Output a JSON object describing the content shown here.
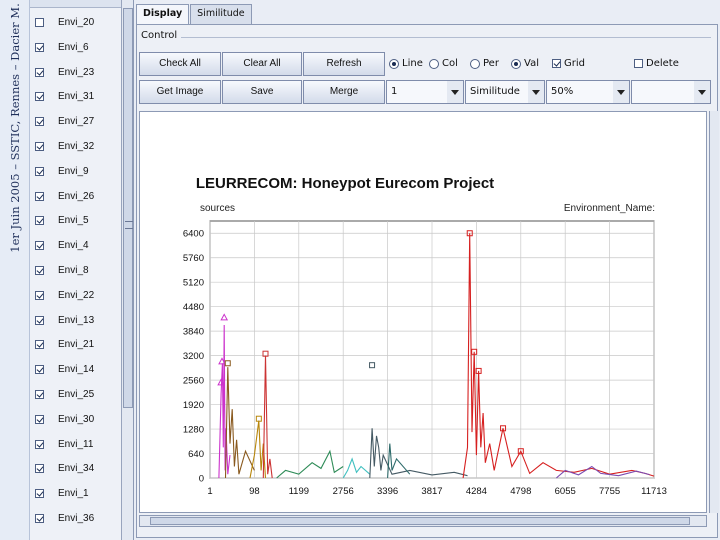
{
  "slide_caption": "1er Juin 2005 – SSTIC, Rennes – Dacier M.",
  "environments": [
    {
      "label": "Envi_20",
      "checked": false
    },
    {
      "label": "Envi_6",
      "checked": true
    },
    {
      "label": "Envi_23",
      "checked": true
    },
    {
      "label": "Envi_31",
      "checked": true
    },
    {
      "label": "Envi_27",
      "checked": true
    },
    {
      "label": "Envi_32",
      "checked": true
    },
    {
      "label": "Envi_9",
      "checked": true
    },
    {
      "label": "Envi_26",
      "checked": true
    },
    {
      "label": "Envi_5",
      "checked": true
    },
    {
      "label": "Envi_4",
      "checked": true
    },
    {
      "label": "Envi_8",
      "checked": true
    },
    {
      "label": "Envi_22",
      "checked": true
    },
    {
      "label": "Envi_13",
      "checked": true
    },
    {
      "label": "Envi_21",
      "checked": true
    },
    {
      "label": "Envi_14",
      "checked": true
    },
    {
      "label": "Envi_25",
      "checked": true
    },
    {
      "label": "Envi_30",
      "checked": true
    },
    {
      "label": "Envi_11",
      "checked": true
    },
    {
      "label": "Envi_34",
      "checked": true
    },
    {
      "label": "Envi_1",
      "checked": true
    },
    {
      "label": "Envi_36",
      "checked": true
    }
  ],
  "tabs": [
    {
      "label": "Display",
      "active": true
    },
    {
      "label": "Similitude",
      "active": false
    }
  ],
  "control": {
    "label": "Control",
    "buttons": {
      "check_all": "Check All",
      "clear_all": "Clear All",
      "refresh": "Refresh",
      "get_image": "Get Image",
      "save": "Save",
      "merge": "Merge"
    },
    "radios": [
      {
        "label": "Line",
        "selected": true
      },
      {
        "label": "Col",
        "selected": false
      },
      {
        "label": "Per",
        "selected": false
      },
      {
        "label": "Val",
        "selected": true
      }
    ],
    "grid": {
      "label": "Grid",
      "checked": true
    },
    "delete": {
      "label": "Delete",
      "checked": false
    },
    "selects": {
      "env_index": "1",
      "mode": "Similitude",
      "zoom": "50%",
      "extra": ""
    }
  },
  "chart_data": {
    "type": "line",
    "title": "LEURRECOM: Honeypot Eurecom Project",
    "ylabel": "sources",
    "legend_label": "Environment_Name:",
    "x_tick_labels": [
      "1",
      "98",
      "1199",
      "2756",
      "3396",
      "3817",
      "4284",
      "4798",
      "6055",
      "7755",
      "11713"
    ],
    "y_ticks": [
      0,
      640,
      1280,
      1920,
      2560,
      3200,
      3840,
      4480,
      5120,
      5760,
      6400
    ],
    "ylim": [
      0,
      6720
    ],
    "grid": true,
    "colors": [
      "#cc33cc",
      "#8a5a1f",
      "#b8860b",
      "#2e8b57",
      "#40c0c0",
      "#455a64",
      "#2e6b6b",
      "#d62020",
      "#7a4ab0",
      "#d4a017"
    ],
    "series": [
      {
        "color": "#cc33cc",
        "points": [
          [
            0.02,
            0
          ],
          [
            0.025,
            2200
          ],
          [
            0.028,
            3000
          ],
          [
            0.03,
            800
          ],
          [
            0.032,
            4000
          ],
          [
            0.034,
            200
          ],
          [
            0.036,
            1300
          ],
          [
            0.04,
            100
          ],
          [
            0.045,
            600
          ]
        ]
      },
      {
        "color": "#8a5a1f",
        "points": [
          [
            0.035,
            0
          ],
          [
            0.04,
            2900
          ],
          [
            0.045,
            900
          ],
          [
            0.05,
            1800
          ],
          [
            0.055,
            300
          ],
          [
            0.06,
            1000
          ],
          [
            0.065,
            100
          ],
          [
            0.08,
            700
          ],
          [
            0.1,
            200
          ]
        ]
      },
      {
        "color": "#b8860b",
        "points": [
          [
            0.09,
            0
          ],
          [
            0.1,
            600
          ],
          [
            0.11,
            1500
          ],
          [
            0.115,
            200
          ],
          [
            0.12,
            900
          ],
          [
            0.125,
            0
          ]
        ]
      },
      {
        "color": "#cc3333",
        "points": [
          [
            0.12,
            0
          ],
          [
            0.125,
            3200
          ],
          [
            0.13,
            100
          ],
          [
            0.135,
            500
          ],
          [
            0.14,
            0
          ]
        ]
      },
      {
        "color": "#2e8b57",
        "points": [
          [
            0.15,
            0
          ],
          [
            0.17,
            200
          ],
          [
            0.2,
            100
          ],
          [
            0.23,
            400
          ],
          [
            0.25,
            250
          ],
          [
            0.27,
            700
          ],
          [
            0.28,
            150
          ],
          [
            0.3,
            300
          ]
        ]
      },
      {
        "color": "#40c0c0",
        "points": [
          [
            0.3,
            0
          ],
          [
            0.31,
            200
          ],
          [
            0.32,
            500
          ],
          [
            0.33,
            150
          ],
          [
            0.34,
            300
          ],
          [
            0.36,
            100
          ]
        ]
      },
      {
        "color": "#455a64",
        "points": [
          [
            0.36,
            0
          ],
          [
            0.365,
            1300
          ],
          [
            0.37,
            300
          ],
          [
            0.375,
            1100
          ],
          [
            0.38,
            800
          ],
          [
            0.385,
            200
          ],
          [
            0.39,
            600
          ],
          [
            0.41,
            100
          ],
          [
            0.45,
            200
          ],
          [
            0.5,
            80
          ],
          [
            0.55,
            150
          ],
          [
            0.58,
            60
          ]
        ]
      },
      {
        "color": "#2e6b6b",
        "points": [
          [
            0.4,
            0
          ],
          [
            0.405,
            900
          ],
          [
            0.41,
            200
          ],
          [
            0.42,
            500
          ],
          [
            0.45,
            100
          ]
        ]
      },
      {
        "color": "#d62020",
        "points": [
          [
            0.57,
            0
          ],
          [
            0.58,
            800
          ],
          [
            0.585,
            6400
          ],
          [
            0.59,
            1200
          ],
          [
            0.595,
            3300
          ],
          [
            0.6,
            600
          ],
          [
            0.605,
            2800
          ],
          [
            0.61,
            800
          ],
          [
            0.615,
            1700
          ],
          [
            0.62,
            400
          ],
          [
            0.63,
            900
          ],
          [
            0.64,
            200
          ],
          [
            0.66,
            1300
          ],
          [
            0.68,
            300
          ],
          [
            0.7,
            700
          ],
          [
            0.72,
            120
          ],
          [
            0.75,
            400
          ],
          [
            0.78,
            200
          ],
          [
            0.82,
            150
          ],
          [
            0.86,
            250
          ],
          [
            0.9,
            100
          ],
          [
            0.95,
            200
          ],
          [
            0.98,
            120
          ],
          [
            1.0,
            50
          ]
        ]
      },
      {
        "color": "#7a4ab0",
        "points": [
          [
            0.78,
            0
          ],
          [
            0.8,
            200
          ],
          [
            0.83,
            80
          ],
          [
            0.86,
            300
          ],
          [
            0.88,
            120
          ],
          [
            0.92,
            60
          ],
          [
            0.96,
            180
          ],
          [
            0.99,
            90
          ]
        ]
      }
    ],
    "markers": [
      {
        "x": 0.025,
        "y": 2500,
        "color": "#cc33cc",
        "shape": "triangle"
      },
      {
        "x": 0.027,
        "y": 3050,
        "color": "#cc33cc",
        "shape": "triangle"
      },
      {
        "x": 0.04,
        "y": 3000,
        "color": "#8a5a1f",
        "shape": "square"
      },
      {
        "x": 0.032,
        "y": 4200,
        "color": "#cc33cc",
        "shape": "triangle"
      },
      {
        "x": 0.125,
        "y": 3250,
        "color": "#cc3333",
        "shape": "square"
      },
      {
        "x": 0.11,
        "y": 1550,
        "color": "#b8860b",
        "shape": "square"
      },
      {
        "x": 0.365,
        "y": 2950,
        "color": "#455a64",
        "shape": "square"
      },
      {
        "x": 0.585,
        "y": 6400,
        "color": "#d62020",
        "shape": "square"
      },
      {
        "x": 0.595,
        "y": 3300,
        "color": "#d62020",
        "shape": "square"
      },
      {
        "x": 0.605,
        "y": 2800,
        "color": "#d62020",
        "shape": "square"
      },
      {
        "x": 0.66,
        "y": 1300,
        "color": "#d62020",
        "shape": "square"
      },
      {
        "x": 0.7,
        "y": 700,
        "color": "#d62020",
        "shape": "square"
      }
    ]
  }
}
